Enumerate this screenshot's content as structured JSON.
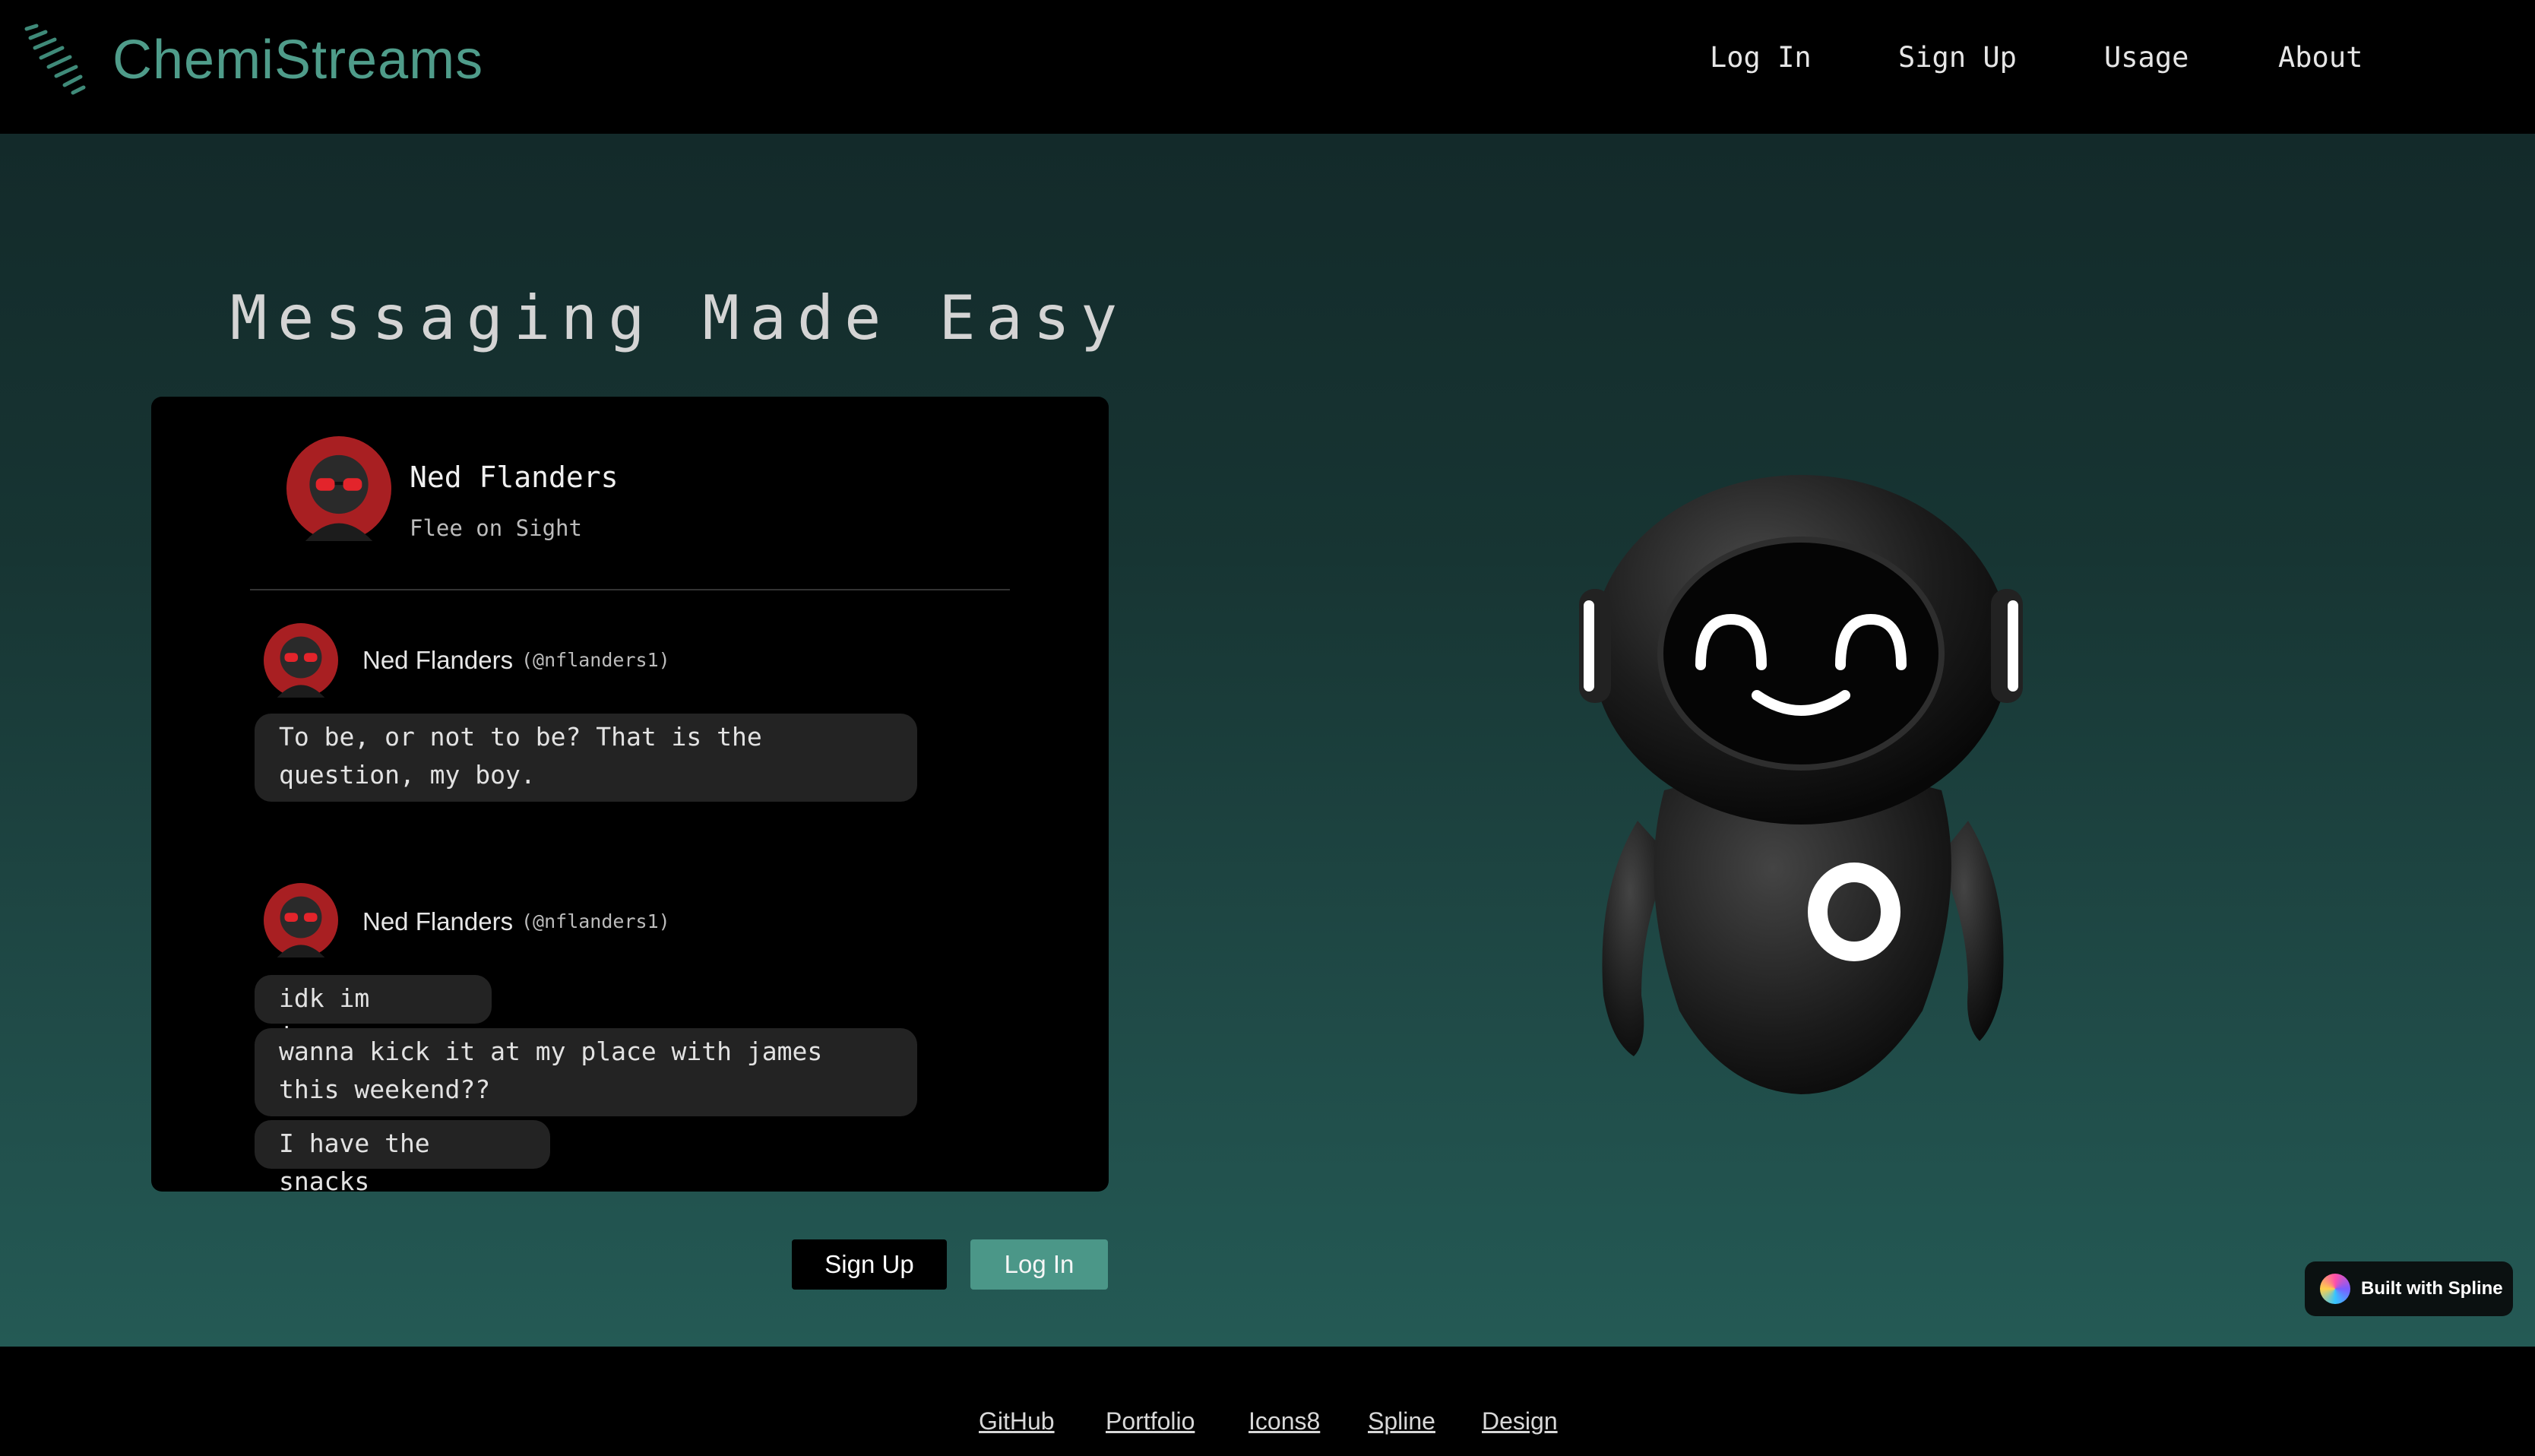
{
  "header": {
    "brand": "ChemiStreams",
    "nav": [
      "Log In",
      "Sign Up",
      "Usage",
      "About"
    ]
  },
  "hero": {
    "headline": "Messaging Made Easy",
    "profile": {
      "name": "Ned Flanders",
      "status": "Flee on Sight"
    },
    "messages": [
      {
        "name": "Ned Flanders",
        "handle": "(@nflanders1)",
        "lines": [
          "To be, or not to be? That is the question, my boy."
        ]
      },
      {
        "name": "Ned Flanders",
        "handle": "(@nflanders1)",
        "lines": [
          "idk im insane",
          "wanna kick it at my place with james this weekend??",
          "I have the snacks"
        ]
      }
    ],
    "buttons": {
      "signup": "Sign Up",
      "login": "Log In"
    }
  },
  "badge": {
    "label": "Built with Spline"
  },
  "footer": {
    "links": [
      "GitHub",
      "Portfolio",
      "Icons8",
      "Spline",
      "Design"
    ]
  },
  "colors": {
    "brand": "#4f9c8a",
    "login_button": "#4b9788",
    "bubble": "#232323"
  }
}
